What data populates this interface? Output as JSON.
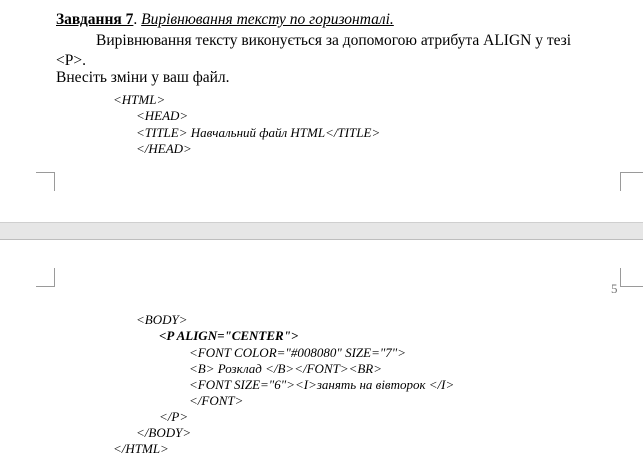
{
  "page1": {
    "heading_task": "Завдання 7",
    "heading_sep": ". ",
    "heading_subtitle": "Вирівнювання тексту по горизонталі.",
    "paragraph": "Вирівнювання тексту виконується за допомогою атрибута ALIGN у тезі <P>.",
    "instruction": "Внесіть зміни у ваш файл.",
    "code": [
      "<HTML>",
      "<HEAD>",
      "<TITLE> Навчальний файл HTML</TITLE>",
      "</HEAD>"
    ]
  },
  "page2": {
    "page_number": "5",
    "code": [
      "<BODY>",
      "<P ALIGN=\"CENTER\">",
      "<FONT COLOR=\"#008080\" SIZE=\"7\">",
      "<B> Розклад </B></FONT><BR>",
      "<FONT SIZE=\"6\"><I>занять на вівторок </I>",
      "</FONT>",
      "</P>",
      "</BODY>",
      "</HTML>"
    ]
  }
}
